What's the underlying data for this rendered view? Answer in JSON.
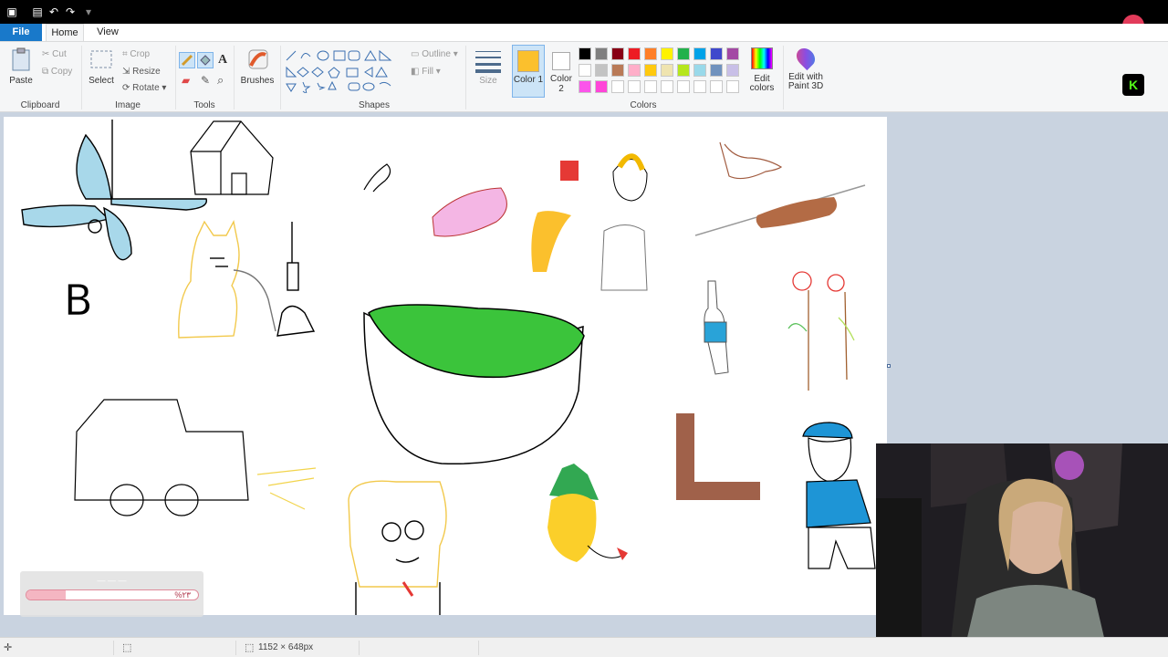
{
  "ribbon": {
    "tabs": [
      "File",
      "Home",
      "View"
    ],
    "clipboard": {
      "paste": "Paste",
      "cut": "Cut",
      "copy": "Copy",
      "label": "Clipboard"
    },
    "image": {
      "select": "Select",
      "crop": "Crop",
      "resize": "Resize",
      "rotate": "Rotate",
      "label": "Image"
    },
    "tools": {
      "label": "Tools",
      "text_icon": "A"
    },
    "brushes": {
      "label": "Brushes"
    },
    "shapes": {
      "label": "Shapes",
      "outline": "Outline",
      "fill": "Fill"
    },
    "size": {
      "label": "Size"
    },
    "colors": {
      "color1_label": "Color 1",
      "color2_label": "Color 2",
      "label": "Colors",
      "edit_colors": "Edit colors",
      "paint3d": "Edit with Paint 3D",
      "color1": "#fbc02d",
      "color2": "#ffffff",
      "palette_row1": [
        "#000000",
        "#7f7f7f",
        "#880015",
        "#ed1c24",
        "#ff7f27",
        "#fff200",
        "#22b14c",
        "#00a2e8",
        "#3f48cc",
        "#a349a4"
      ],
      "palette_row2": [
        "#ffffff",
        "#c3c3c3",
        "#b97a57",
        "#ffaec9",
        "#ffc90e",
        "#efe4b0",
        "#b5e61d",
        "#99d9ea",
        "#7092be",
        "#c8bfe7"
      ],
      "palette_row3": [
        "#fb55ea",
        "#ff45d8",
        "",
        "",
        "",
        "",
        "",
        "",
        "",
        ""
      ]
    }
  },
  "canvas": {
    "letter": "B"
  },
  "status": {
    "dimensions": "1152 × 648px"
  },
  "overlay": {
    "progress_percent": 23,
    "progress_text": "%۲۳"
  },
  "accent": "#1979ca",
  "right_panel": {
    "kick_icon": "K"
  }
}
